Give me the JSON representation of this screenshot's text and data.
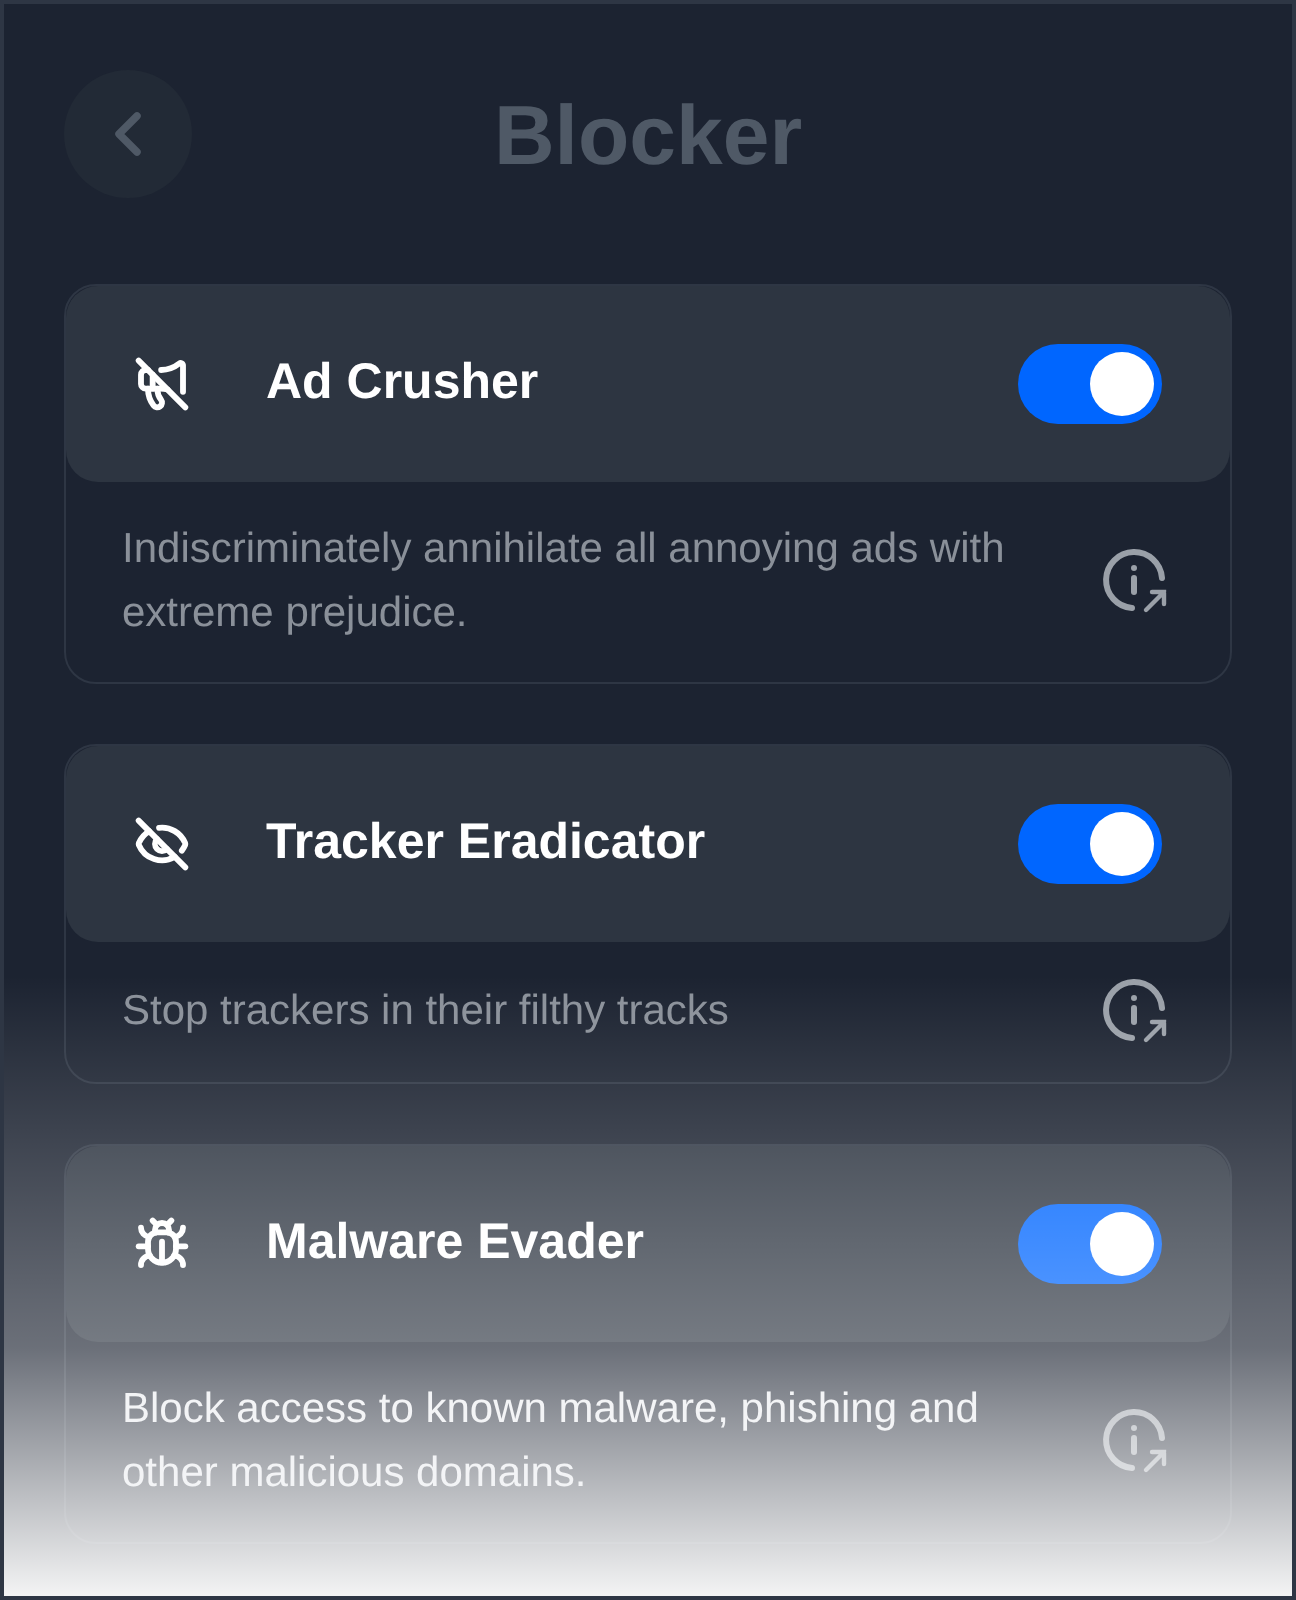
{
  "header": {
    "title": "Blocker"
  },
  "blockers": [
    {
      "kind": "megaphone-off",
      "name": "Ad Crusher",
      "on": true,
      "description": "Indiscriminately annihilate all annoying ads with extreme prejudice."
    },
    {
      "kind": "eye-off",
      "name": "Tracker Eradicator",
      "on": true,
      "description": "Stop trackers in their filthy tracks"
    },
    {
      "kind": "bug",
      "name": "Malware Evader",
      "on": true,
      "description": "Block access to known malware, phishing and other malicious domains."
    }
  ]
}
